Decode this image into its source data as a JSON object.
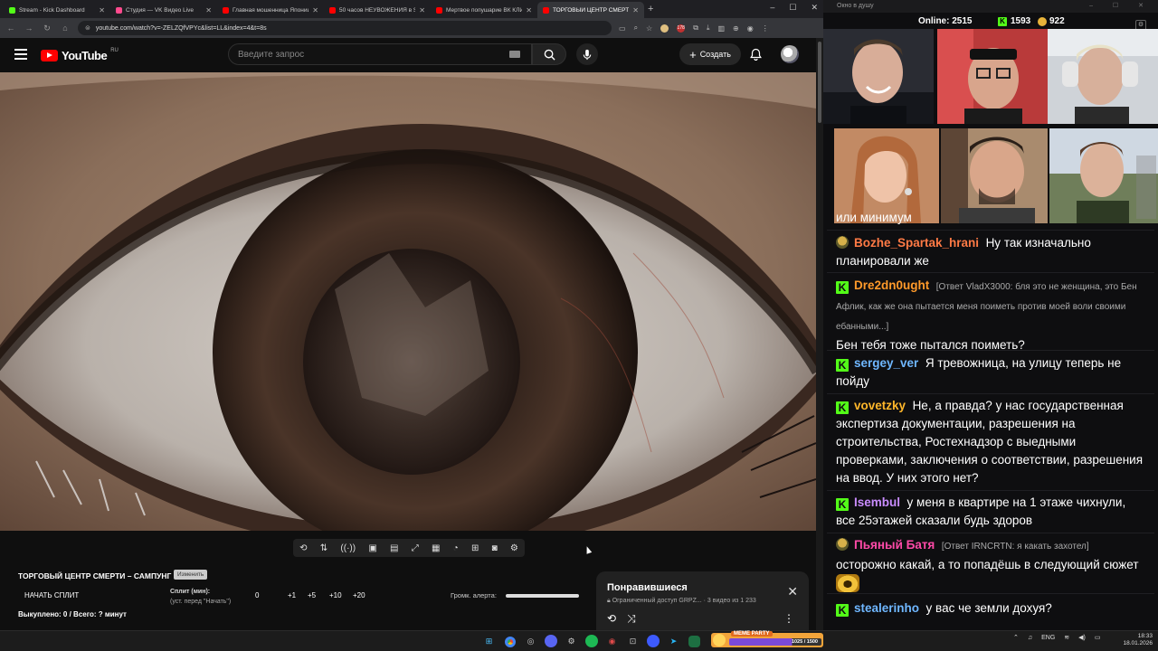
{
  "browser": {
    "tabs": [
      {
        "title": "Stream - Kick Dashboard",
        "color": "#53fc18"
      },
      {
        "title": "Студия — VK Видео Live",
        "color": "#ff4a8d"
      },
      {
        "title": "Главная мошенница Японии",
        "color": "#ff0000"
      },
      {
        "title": "50 часов НЕУВОЖЕНИЯ в SAM",
        "color": "#ff0000"
      },
      {
        "title": "Мертвое попушарие ВК КЛИ",
        "color": "#ff0000"
      },
      {
        "title": "ТОРГОВЫЙ ЦЕНТР СМЕРТИ",
        "color": "#ff0000"
      }
    ],
    "new_tab": "+",
    "window_controls": [
      "–",
      "☐",
      "✕"
    ],
    "url": "youtube.com/watch?v=-ZELZQfVPYc&list=LL&index=4&t=8s",
    "ext_badge": "178"
  },
  "youtube": {
    "logo_text": "YouTube",
    "region": "RU",
    "search_placeholder": "Введите запрос",
    "create_label": "Создать"
  },
  "controls": {
    "icons": [
      "repeat-icon",
      "sort-icon",
      "broadcast-icon",
      "watch-icon",
      "clip-icon",
      "resize-icon",
      "frames-icon",
      "speed-icon",
      "add-icon",
      "camera-icon",
      "gear-icon"
    ]
  },
  "split_panel": {
    "title": "ТОРГОВЫЙ ЦЕНТР СМЕРТИ – САМПУНГ",
    "tag": "Изменить",
    "start_button": "НАЧАТЬ СПЛИТ",
    "split_label": "Сплит (мин):",
    "split_hint": "(уст. перед \"Начать\")",
    "split_value": "0",
    "increments": [
      "+1",
      "+5",
      "+10",
      "+20"
    ],
    "alert_label": "Громк. алерта:",
    "alert_volume": 1.0,
    "bought_text": "Выкуплено: 0 / Всего: ? минут"
  },
  "liked_popup": {
    "title": "Понравившиеся",
    "subtitle_access": "Ограниченный доступ",
    "subtitle_owner": "GRPZ...",
    "subtitle_count": "· 3 видео из 1 233"
  },
  "overlay": {
    "window_title": "Окно в душу",
    "online_label": "Online:",
    "online_count": "2515",
    "kick_count": "1593",
    "points_count": "922"
  },
  "chat": {
    "messages": [
      {
        "badge": "none",
        "user": "",
        "user_color": "#ffffff",
        "reply": "",
        "text": "или минимум"
      },
      {
        "badge": "points",
        "user": "Bozhe_Spartak_hrani",
        "user_color": "#ff7a45",
        "reply": "",
        "text": "Ну так изначально планировали же"
      },
      {
        "badge": "kick",
        "user": "Dre2dn0ught",
        "user_color": "#ff9a2a",
        "reply": "[Ответ VladX3000: бля это не женщина, это Бен Афлик, как же она пытается меня поиметь против моей воли своими ебанными...]",
        "text": "Бен тебя тоже пытался поиметь?"
      },
      {
        "badge": "kick",
        "user": "sergey_ver",
        "user_color": "#6fb7ff",
        "reply": "",
        "text": "Я тревожница, на улицу теперь не пойду"
      },
      {
        "badge": "kick",
        "user": "vovetzky",
        "user_color": "#ffb72a",
        "reply": "",
        "text": "Не, а правда? у нас государственная экспертиза документации, разрешения на строительства, Ростехнадзор с выедными проверками, заключения о соответствии, разрешения на ввод. У них этого нет?"
      },
      {
        "badge": "kick",
        "user": "Isembul",
        "user_color": "#c98cff",
        "reply": "",
        "text": "у меня в квартире на 1 этаже чихнули, все 25этажей сказали будь здоров"
      },
      {
        "badge": "points",
        "user": "Пьяный Батя",
        "user_color": "#ff4aa8",
        "reply": "[Ответ IRNCRTN: я какать захотел]",
        "text": "осторожно какай, а то попадёшь в следующий сюжет"
      },
      {
        "badge": "kick",
        "user": "stealerinho",
        "user_color": "#6fb7ff",
        "reply": "",
        "text": "у вас че земли дохуя?"
      }
    ]
  },
  "taskbar": {
    "meme_title": "MEME PARTY",
    "meme_progress": "1025 / 1500",
    "meme_fraction": 0.68,
    "lang": "ENG",
    "time": "18:33",
    "date": "18.01.2026"
  }
}
